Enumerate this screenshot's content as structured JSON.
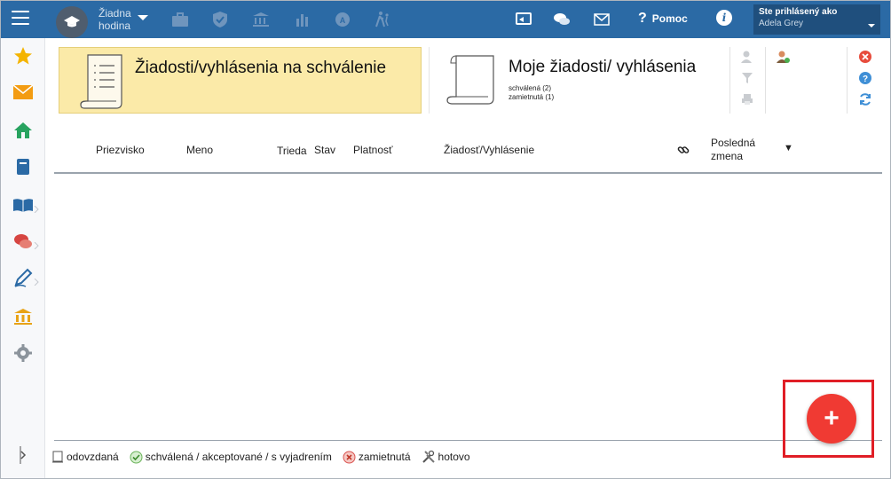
{
  "topbar": {
    "hour_line1": "Žiadna",
    "hour_line2": "hodina",
    "help_label": "Pomoc",
    "user_label": "Ste prihlásený ako",
    "user_name": "Adela Grey"
  },
  "cards": {
    "pending_title": "Žiadosti/vyhlásenia na schválenie",
    "mine_title": "Moje žiadosti/ vyhlásenia",
    "mine_approved": "schválená (2)",
    "mine_rejected": "zamietnutá (1)"
  },
  "table": {
    "columns": [
      "Priezvisko",
      "Meno",
      "Trieda",
      "Stav",
      "Platnosť",
      "Žiadosť/Vyhlásenie",
      "Posledná",
      "zmena"
    ],
    "sort_indicator": "▼"
  },
  "legend": {
    "sent": "odovzdaná",
    "approved": "schválená / akceptované / s vyjadrením",
    "rejected": "zamietnutá",
    "done": "hotovo"
  },
  "fab": {
    "label": "+"
  },
  "colors": {
    "topbar": "#2b6aa5",
    "card_highlight": "#fbeaa8",
    "fab": "#f03a33",
    "highlight_frame": "#e01e26"
  },
  "icons": {
    "sidebar": [
      "star-icon",
      "mail-icon",
      "home-icon",
      "book-icon",
      "open-book-icon",
      "chat-icon",
      "pencil-icon",
      "bank-icon",
      "gear-icon"
    ],
    "topbar": [
      "briefcase-icon",
      "shield-icon",
      "bank-icon",
      "bar-chart-icon",
      "grade-icon",
      "walking-icon",
      "cast-icon",
      "chat-icon",
      "mail-icon"
    ]
  }
}
